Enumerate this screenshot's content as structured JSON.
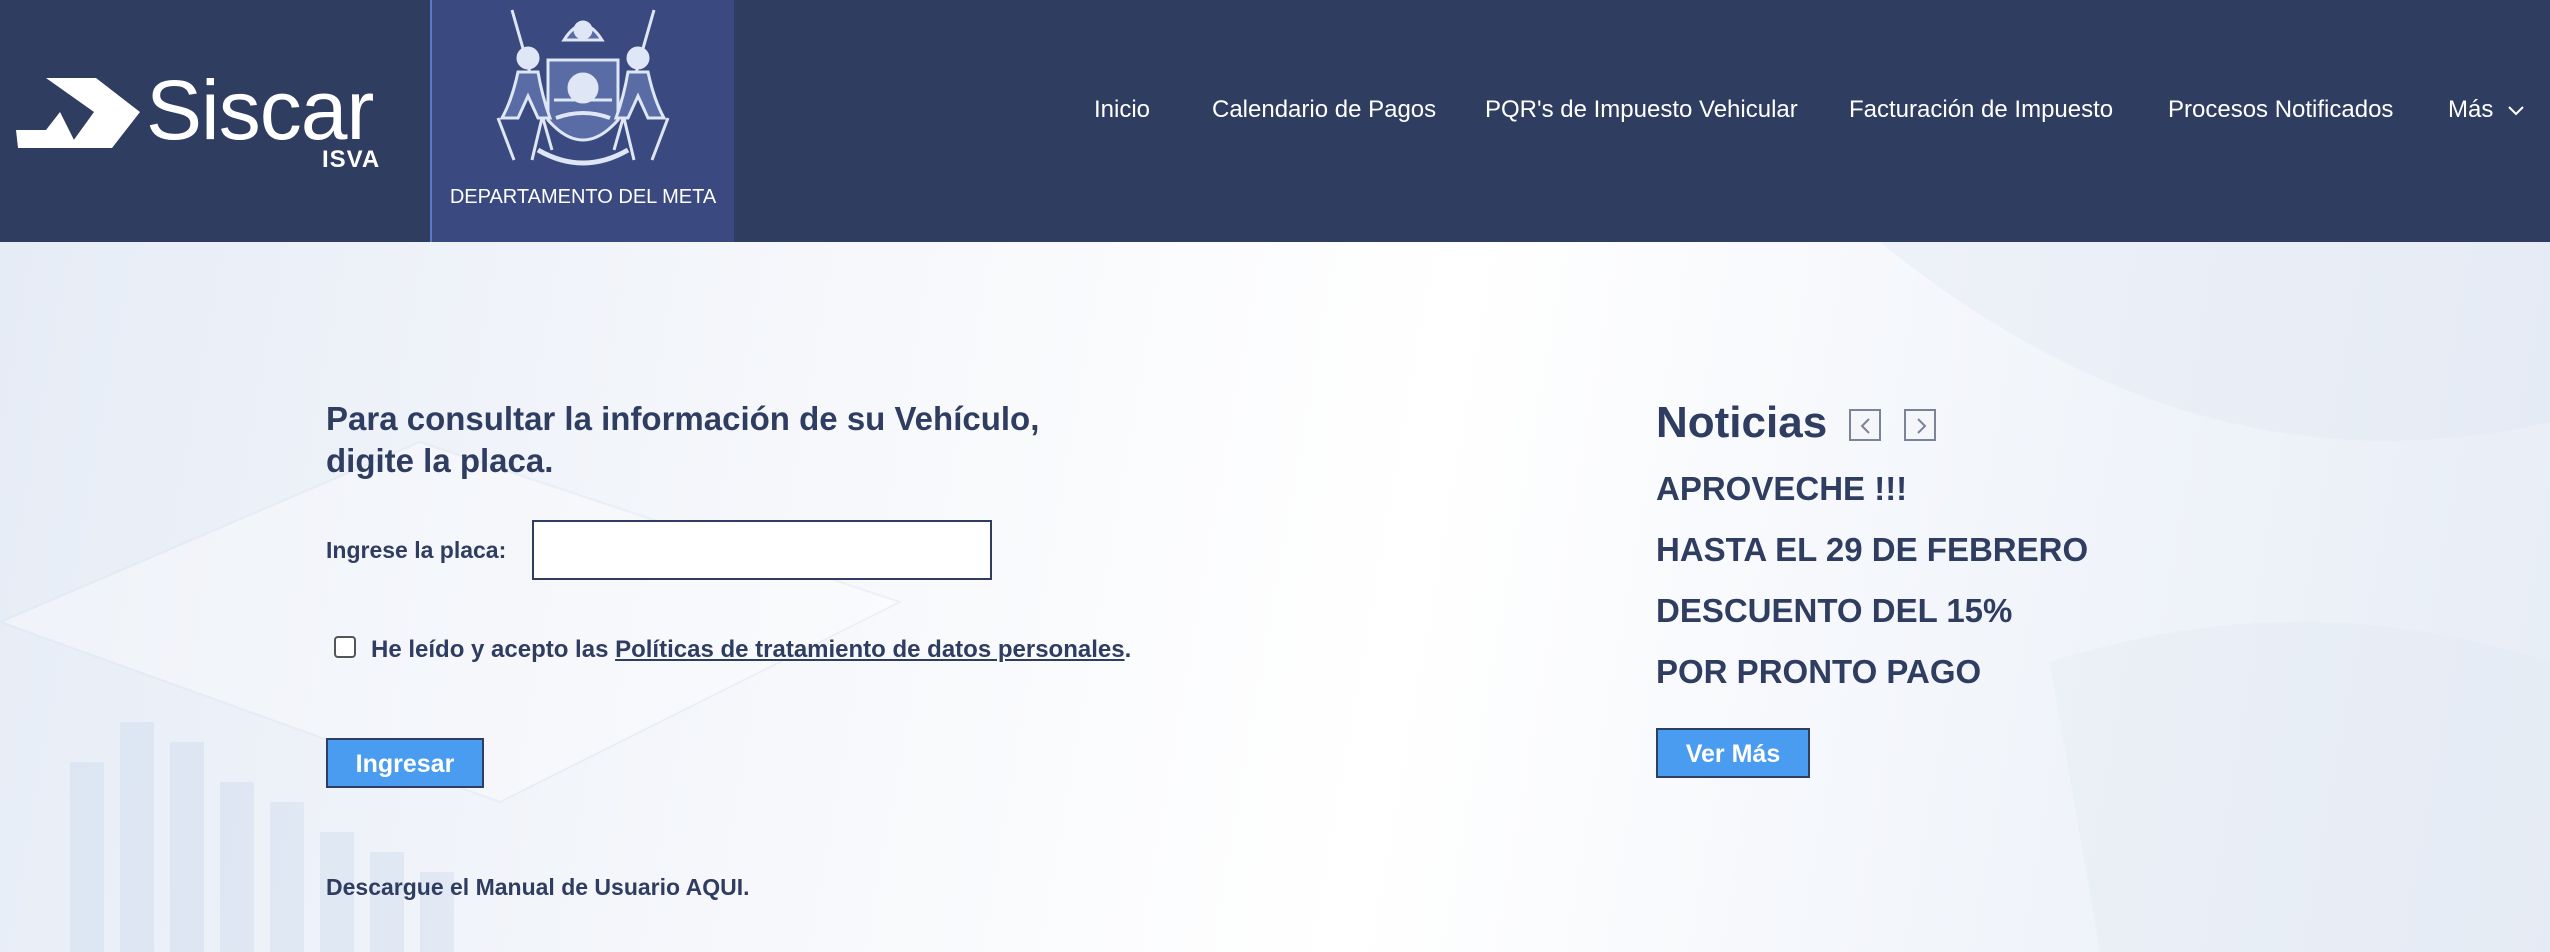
{
  "header": {
    "brand": "Siscar",
    "brand_sub": "ISVA",
    "department": "DEPARTAMENTO DEL META",
    "nav": [
      {
        "label": "Inicio"
      },
      {
        "label": "Calendario de Pagos"
      },
      {
        "label": "PQR's de Impuesto Vehicular"
      },
      {
        "label": "Facturación de Impuesto"
      },
      {
        "label": "Procesos Notificados"
      },
      {
        "label": "Más"
      }
    ]
  },
  "form": {
    "heading": "Para consultar la información de su Vehículo, digite la placa.",
    "plate_label": "Ingrese la placa:",
    "plate_value": "",
    "consent_prefix": "He leído y acepto las ",
    "consent_link": "Políticas de tratamiento de datos personales",
    "consent_suffix": ".",
    "consent_checked": false,
    "submit_label": "Ingresar",
    "manual_text": "Descargue el Manual de Usuario AQUI."
  },
  "news": {
    "title": "Noticias",
    "lines": [
      "APROVECHE !!!",
      "HASTA EL 29 DE FEBRERO",
      "DESCUENTO DEL 15%",
      "POR PRONTO PAGO"
    ],
    "more_label": "Ver Más",
    "prev_icon": "chevron-left-icon",
    "next_icon": "chevron-right-icon"
  },
  "colors": {
    "header_bg": "#2f3d61",
    "dept_bg": "#3a4a80",
    "text": "#2f3d61",
    "button": "#4a9cf0"
  }
}
